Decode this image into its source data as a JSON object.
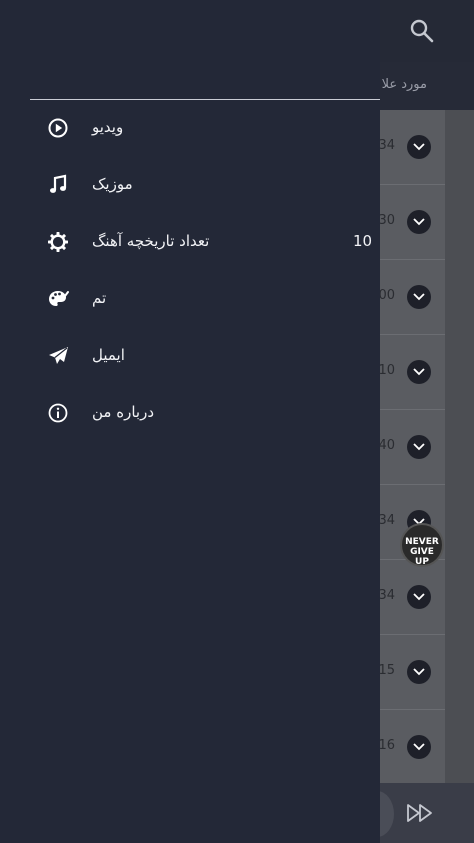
{
  "background": {
    "tab_label": "مورد علا",
    "rows": [
      {
        "num": "34"
      },
      {
        "num": "30"
      },
      {
        "num": "00"
      },
      {
        "num": "10"
      },
      {
        "num": "40"
      },
      {
        "num": "34"
      },
      {
        "num": "34"
      },
      {
        "num": "15"
      },
      {
        "num": "16"
      }
    ],
    "badge_text_line1": "NEVER",
    "badge_text_line2": "GIVE UP"
  },
  "drawer": {
    "items": [
      {
        "label": "ویدیو",
        "icon": "play-circle-icon"
      },
      {
        "label": "موزیک",
        "icon": "music-note-icon"
      },
      {
        "label": "تعداد تاریخچه آهنگ",
        "icon": "gear-icon",
        "value": "10"
      },
      {
        "label": "تم",
        "icon": "palette-icon"
      },
      {
        "label": "ایمیل",
        "icon": "send-icon"
      },
      {
        "label": "درباره من",
        "icon": "info-icon"
      }
    ]
  },
  "colors": {
    "drawer_bg": "#232837",
    "topbar_bg": "#252936",
    "list_bg": "#5a5c61",
    "text": "#f2f3f6"
  }
}
